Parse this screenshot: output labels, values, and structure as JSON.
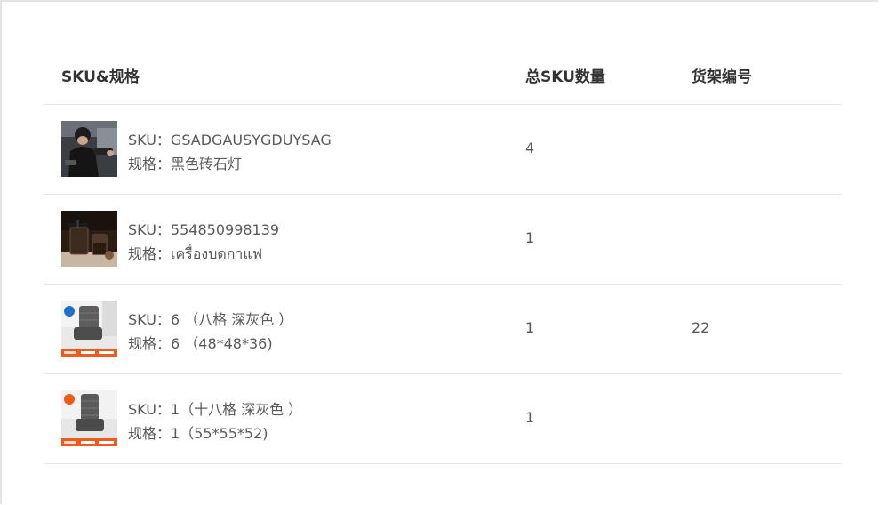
{
  "table": {
    "headers": {
      "sku_spec": "SKU&规格",
      "total_qty": "总SKU数量",
      "shelf_no": "货架编号"
    },
    "rows": [
      {
        "thumb_icon": "person-photo",
        "sku": "SKU：GSADGAUSYGDUYSAG",
        "spec": "规格：黑色砖石灯",
        "qty": "4",
        "shelf": ""
      },
      {
        "thumb_icon": "coffee-grinder-photo",
        "sku": "SKU：554850998139",
        "spec": "规格：เครื่องบดกาแฟ",
        "qty": "1",
        "shelf": ""
      },
      {
        "thumb_icon": "floor-chair-photo",
        "sku": "SKU：6 （八格 深灰色 ）",
        "spec": "规格：6 （48*48*36)",
        "qty": "1",
        "shelf": "22"
      },
      {
        "thumb_icon": "floor-chair-photo",
        "sku": "SKU：1（十八格 深灰色 ）",
        "spec": "规格：1（55*55*52)",
        "qty": "1",
        "shelf": ""
      }
    ]
  }
}
